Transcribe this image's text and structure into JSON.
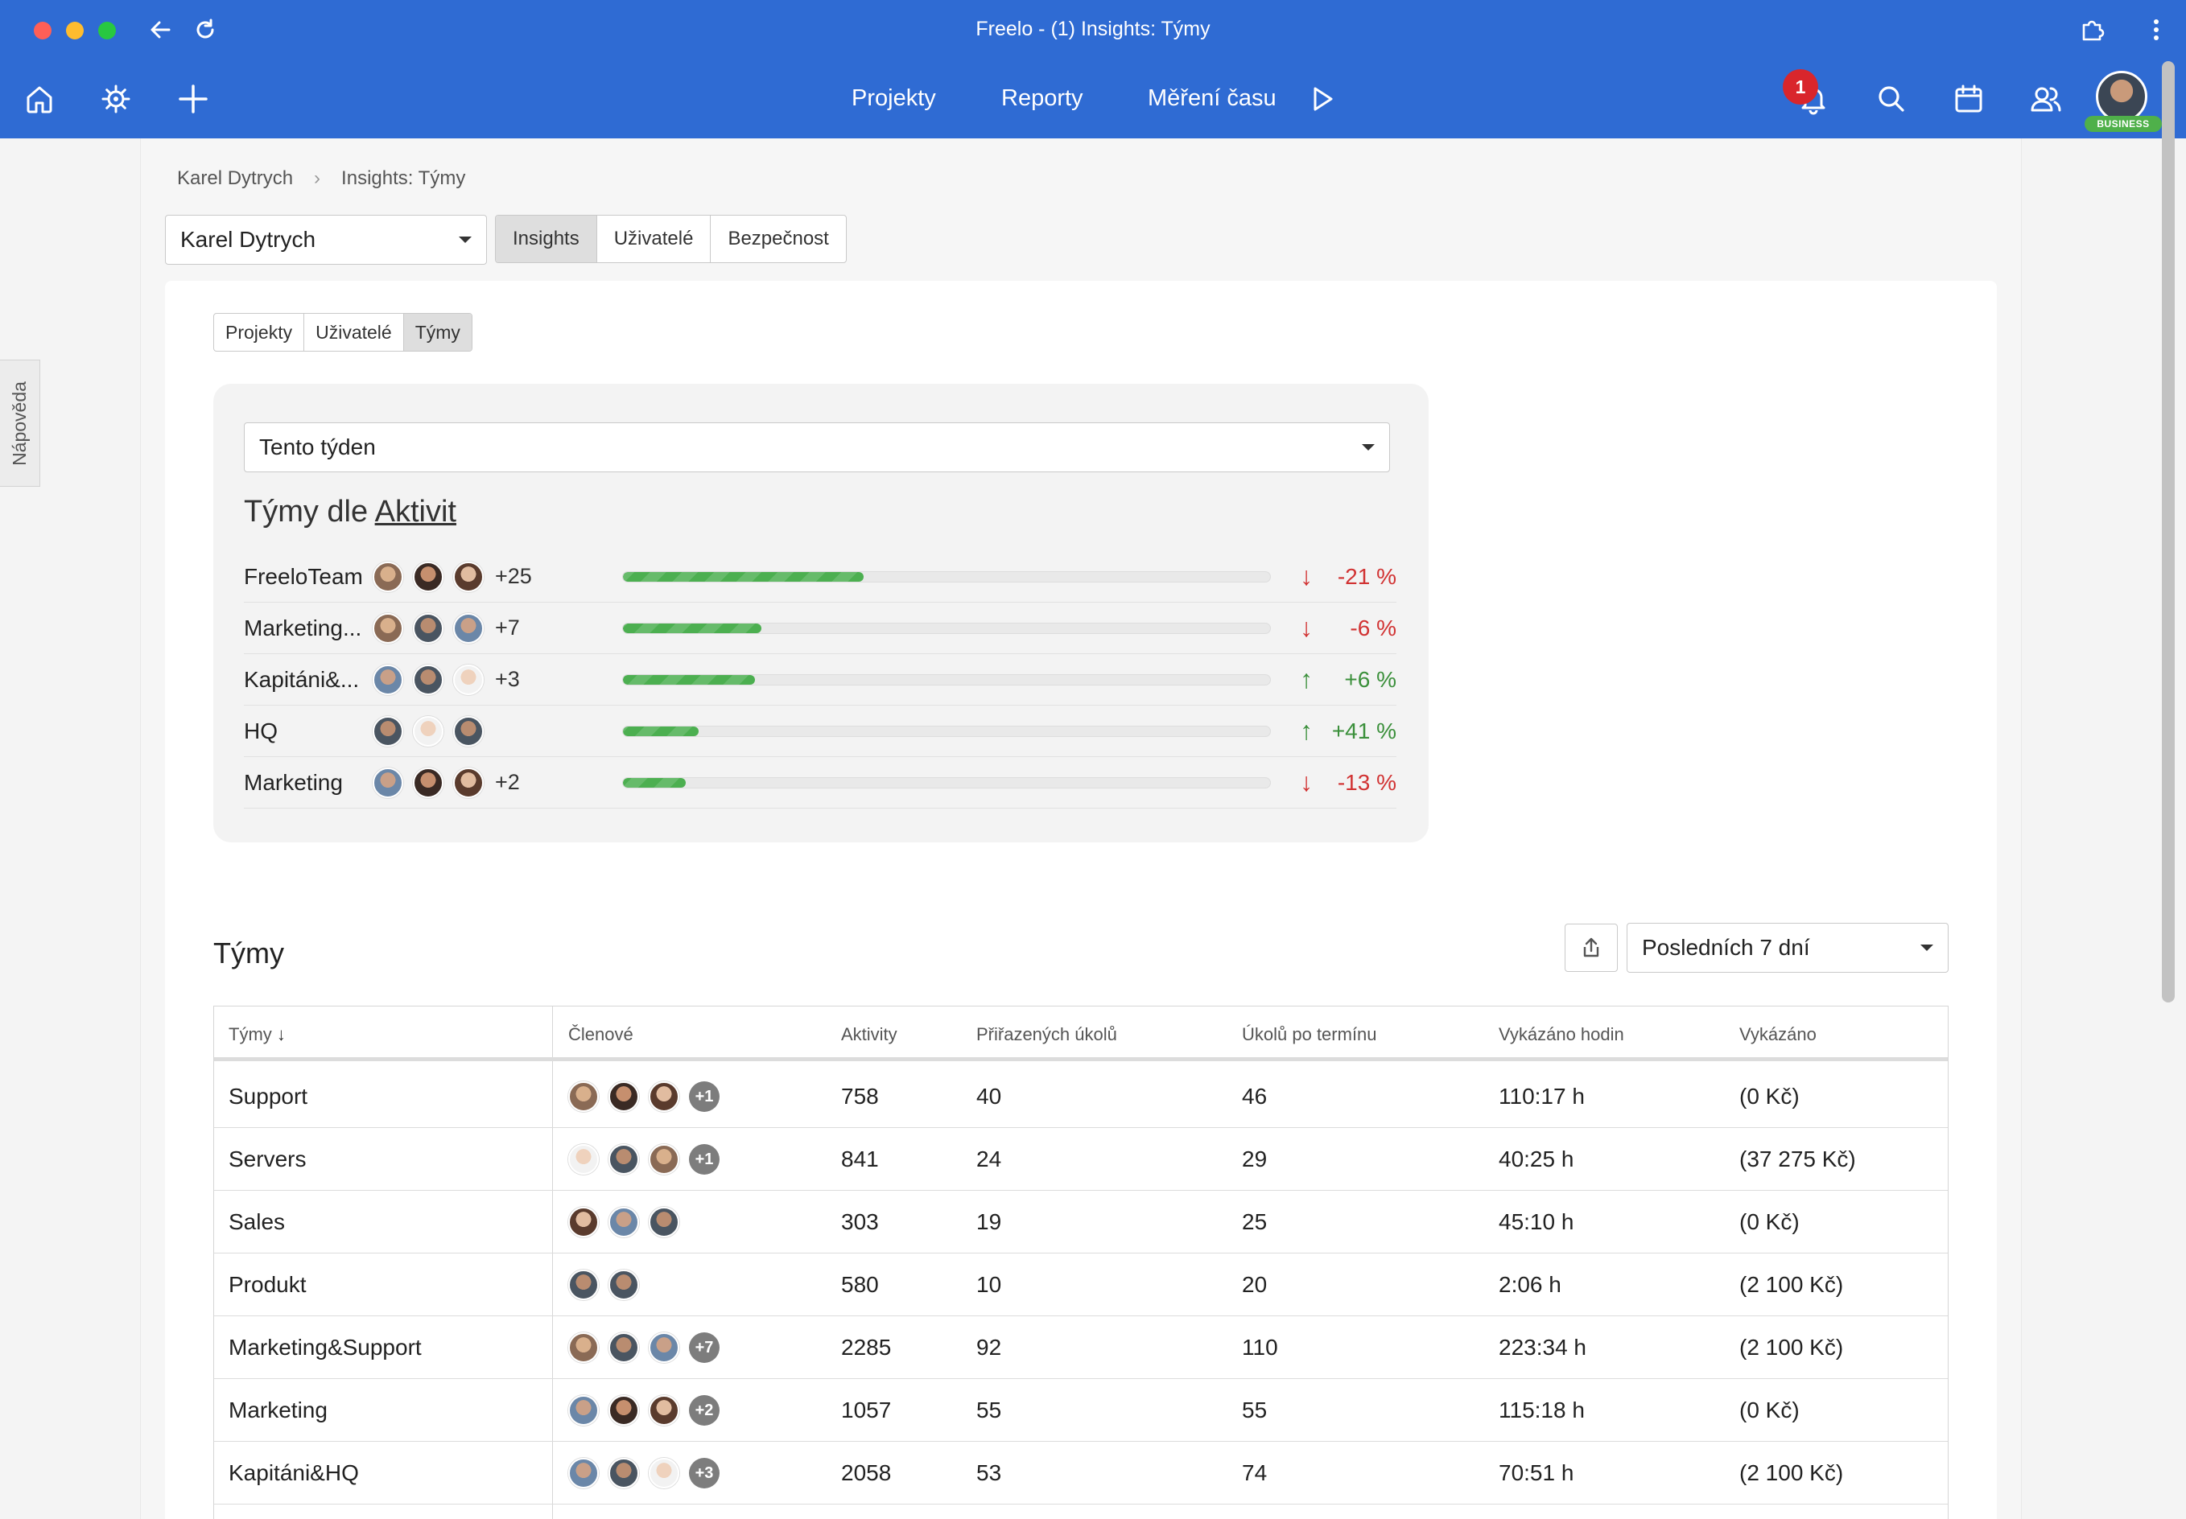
{
  "window": {
    "title": "Freelo - (1) Insights: Týmy"
  },
  "nav": {
    "links": [
      "Projekty",
      "Reporty",
      "Měření času"
    ],
    "notification_count": "1",
    "profile_badge": "BUSINESS"
  },
  "help_tab": "Nápověda",
  "breadcrumb": {
    "root": "Karel Dytrych",
    "current": "Insights: Týmy"
  },
  "org_select": {
    "value": "Karel Dytrych"
  },
  "main_tabs": [
    "Insights",
    "Uživatelé",
    "Bezpečnost"
  ],
  "sub_tabs": [
    "Projekty",
    "Uživatelé",
    "Týmy"
  ],
  "insights": {
    "range": "Tento týden",
    "title_prefix": "Týmy dle",
    "title_link": "Aktivit",
    "rows": [
      {
        "name": "FreeloTeam",
        "more": "+25",
        "fill": 0.372,
        "trend": "down",
        "change": "-21 %"
      },
      {
        "name": "Marketing...",
        "more": "+7",
        "fill": 0.214,
        "trend": "down",
        "change": "-6 %"
      },
      {
        "name": "Kapitáni&...",
        "more": "+3",
        "fill": 0.204,
        "trend": "up",
        "change": "+6 %"
      },
      {
        "name": "HQ",
        "more": "",
        "fill": 0.117,
        "trend": "up",
        "change": "+41 %"
      },
      {
        "name": "Marketing",
        "more": "+2",
        "fill": 0.097,
        "trend": "down",
        "change": "-13 %"
      }
    ]
  },
  "teams": {
    "title": "Týmy",
    "period": "Posledních 7 dní",
    "columns": [
      "Týmy",
      "Členové",
      "Aktivity",
      "Přiřazených úkolů",
      "Úkolů po termínu",
      "Vykázáno hodin",
      "Vykázáno"
    ],
    "rows": [
      {
        "team": "Support",
        "more": "+1",
        "activities": "758",
        "assigned": "40",
        "overdue": "46",
        "hours": "110:17 h",
        "reported": "(0 Kč)"
      },
      {
        "team": "Servers",
        "more": "+1",
        "activities": "841",
        "assigned": "24",
        "overdue": "29",
        "hours": "40:25 h",
        "reported": "(37 275 Kč)"
      },
      {
        "team": "Sales",
        "more": "",
        "activities": "303",
        "assigned": "19",
        "overdue": "25",
        "hours": "45:10 h",
        "reported": "(0 Kč)"
      },
      {
        "team": "Produkt",
        "more": "",
        "activities": "580",
        "assigned": "10",
        "overdue": "20",
        "hours": "2:06 h",
        "reported": "(2 100 Kč)"
      },
      {
        "team": "Marketing&Support",
        "more": "+7",
        "activities": "2285",
        "assigned": "92",
        "overdue": "110",
        "hours": "223:34 h",
        "reported": "(2 100 Kč)"
      },
      {
        "team": "Marketing",
        "more": "+2",
        "activities": "1057",
        "assigned": "55",
        "overdue": "55",
        "hours": "115:18 h",
        "reported": "(0 Kč)"
      },
      {
        "team": "Kapitáni&HQ",
        "more": "+3",
        "activities": "2058",
        "assigned": "53",
        "overdue": "74",
        "hours": "70:51 h",
        "reported": "(2 100 Kč)"
      }
    ]
  },
  "colors": {
    "brand": "#2f6bd3",
    "bar": "#4caf50",
    "down": "#d13232",
    "up": "#3a8f3a",
    "badge": "#d9262c"
  }
}
